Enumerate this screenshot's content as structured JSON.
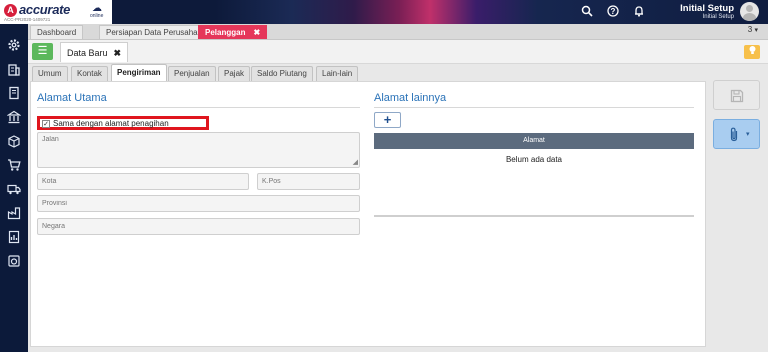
{
  "app": {
    "logo_mark": "A",
    "logo_name": "accurate",
    "logo_edition": "online",
    "logo_id": "ACC-PR2020-1409721"
  },
  "topbar": {
    "icons": [
      "search-icon",
      "help-icon",
      "bell-icon"
    ],
    "user_name": "Initial Setup",
    "user_sub": "Initial Setup"
  },
  "sidebar": {
    "icons": [
      "gear-icon",
      "building-icon",
      "book-icon",
      "bank-icon",
      "cart-icon",
      "store-icon",
      "truck-icon",
      "factory-icon",
      "report-icon",
      "dashboard-icon"
    ]
  },
  "tabs": {
    "items": [
      {
        "label": "Dashboard"
      },
      {
        "label": "Persiapan Data Perusahaan"
      },
      {
        "label": "Pelanggan",
        "close": "✖"
      }
    ],
    "count": "3",
    "count_caret": "▾"
  },
  "subbar": {
    "menu_icon": "☰",
    "doc_tab_label": "Data Baru",
    "doc_tab_close": "✖",
    "bulb_icon": "💡"
  },
  "form_tabs": [
    "Umum",
    "Kontak",
    "Pengiriman",
    "Penjualan",
    "Pajak",
    "Saldo Piutang",
    "Lain-lain"
  ],
  "alamat_utama": {
    "title": "Alamat Utama",
    "checkbox_label": "Sama dengan alamat penagihan",
    "checked": true,
    "checkmark": "✓",
    "jalan_placeholder": "Jalan",
    "kota_placeholder": "Kota",
    "kpos_placeholder": "K.Pos",
    "provinsi_placeholder": "Provinsi",
    "negara_placeholder": "Negara"
  },
  "alamat_lainnya": {
    "title": "Alamat lainnya",
    "add_label": "+",
    "column_header": "Alamat",
    "empty_text": "Belum ada data"
  },
  "actions": {
    "attach_icon": "📎",
    "attach_caret": "▾"
  }
}
